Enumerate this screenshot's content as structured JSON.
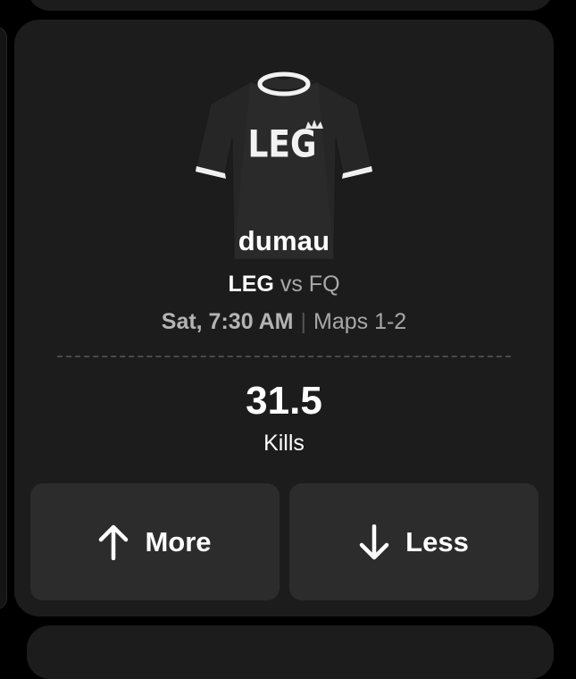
{
  "player": {
    "name": "dumau",
    "jersey_text": "LEG"
  },
  "matchup": {
    "team": "LEG",
    "vs_label": "vs",
    "opponent": "FQ"
  },
  "schedule": {
    "time": "Sat, 7:30 AM",
    "separator": "|",
    "maps": "Maps 1-2"
  },
  "projection": {
    "value": "31.5",
    "stat": "Kills"
  },
  "buttons": {
    "more": {
      "label": "More",
      "icon": "arrow-up-icon"
    },
    "less": {
      "label": "Less",
      "icon": "arrow-down-icon"
    }
  },
  "colors": {
    "card_bg": "#1c1c1d",
    "button_bg": "#2c2c2d",
    "muted_text": "#a8a8a8"
  }
}
